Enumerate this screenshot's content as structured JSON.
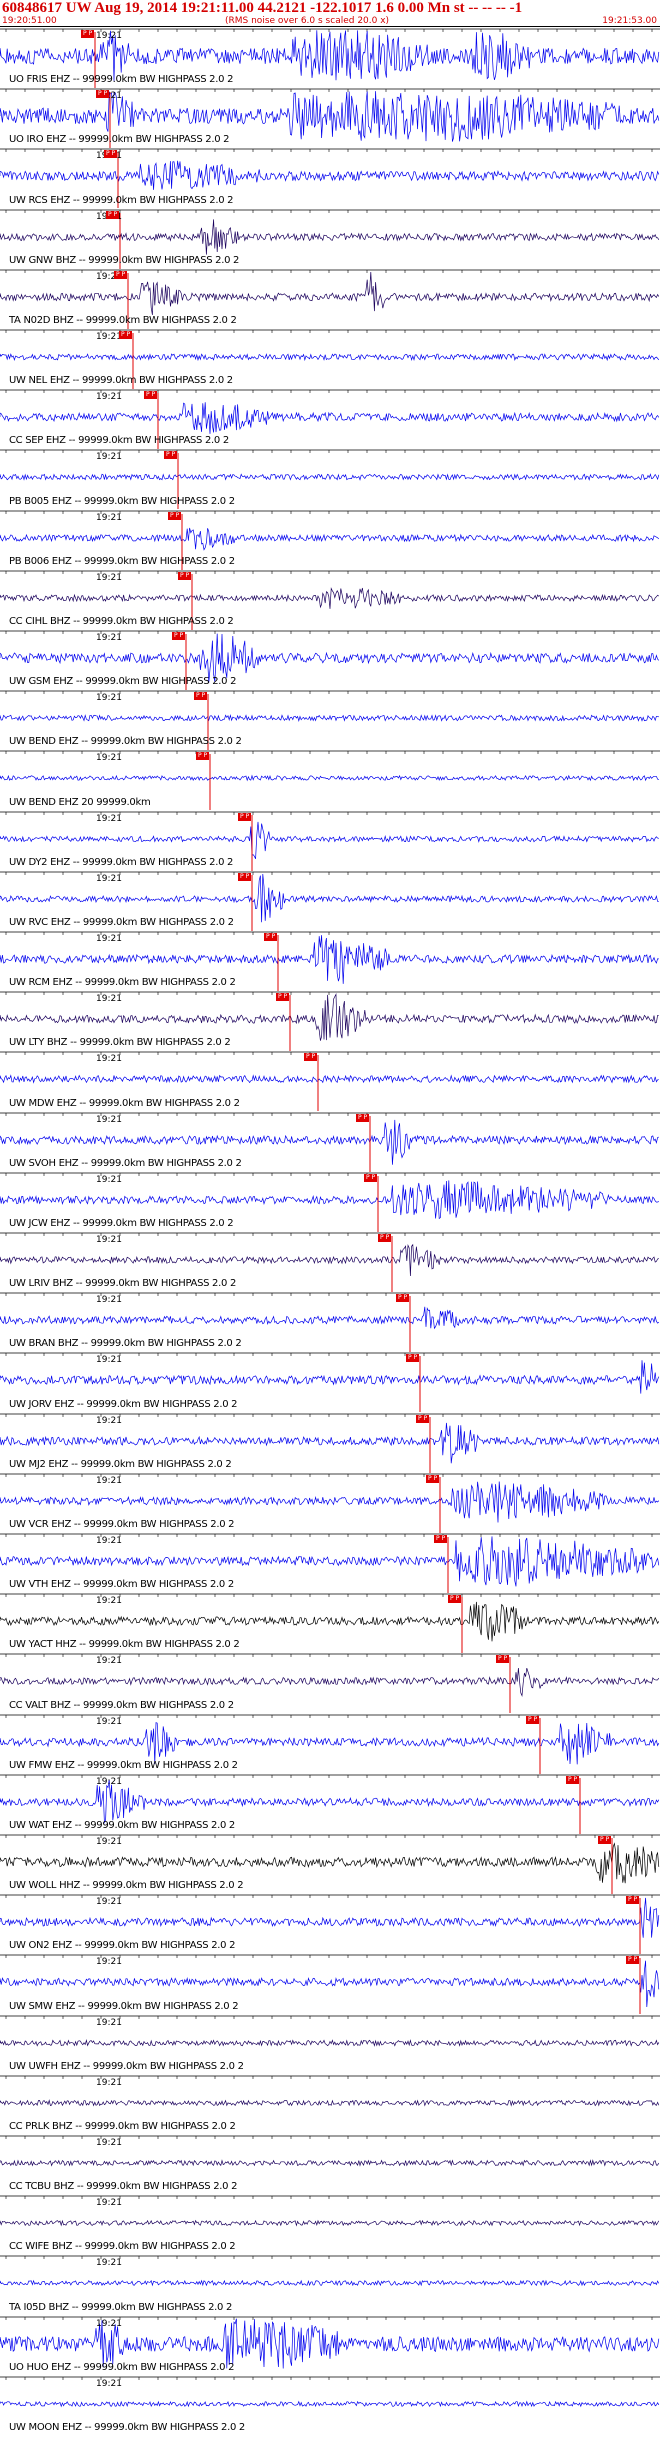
{
  "header": {
    "title": "60848617 UW Aug 19, 2014 19:21:11.00   44.2121 -122.1017  1.6 0.00 Mn st -- -- --  -1",
    "subtitle": "(RMS noise over 6.0 s scaled 20.0 x)",
    "time_left": "19:20:51.00",
    "time_right": "19:21:53.00"
  },
  "tick_label": "19:21",
  "pick_label": "P P",
  "colors": {
    "header_text": "#d40000",
    "trace_blue": "#0000ee",
    "trace_dark": "#1a005c",
    "trace_black": "#000000",
    "pick_red": "#e00000"
  },
  "traces": [
    {
      "label": "UO FRIS EHZ -- 99999.0km BW  HIGHPASS  2.0  2"
    },
    {
      "label": "UO IRO EHZ -- 99999.0km BW  HIGHPASS  2.0  2"
    },
    {
      "label": "UW RCS EHZ -- 99999.0km BW  HIGHPASS  2.0  2"
    },
    {
      "label": "UW GNW BHZ -- 99999.0km BW  HIGHPASS  2.0  2"
    },
    {
      "label": "TA N02D BHZ -- 99999.0km BW  HIGHPASS  2.0  2"
    },
    {
      "label": "UW NEL EHZ -- 99999.0km BW  HIGHPASS  2.0  2"
    },
    {
      "label": "CC SEP EHZ -- 99999.0km BW  HIGHPASS  2.0  2"
    },
    {
      "label": "PB B005 EHZ -- 99999.0km BW  HIGHPASS  2.0  2"
    },
    {
      "label": "PB B006 EHZ -- 99999.0km BW  HIGHPASS  2.0  2"
    },
    {
      "label": "CC CIHL BHZ -- 99999.0km BW  HIGHPASS  2.0  2"
    },
    {
      "label": "UW GSM EHZ -- 99999.0km BW  HIGHPASS  2.0  2"
    },
    {
      "label": "UW BEND EHZ -- 99999.0km BW  HIGHPASS  2.0  2"
    },
    {
      "label": "UW BEND EHZ 20 99999.0km"
    },
    {
      "label": "UW DY2 EHZ -- 99999.0km BW  HIGHPASS  2.0  2"
    },
    {
      "label": "UW RVC EHZ -- 99999.0km BW  HIGHPASS  2.0  2"
    },
    {
      "label": "UW RCM EHZ -- 99999.0km BW  HIGHPASS  2.0  2"
    },
    {
      "label": "UW LTY BHZ -- 99999.0km BW  HIGHPASS  2.0  2"
    },
    {
      "label": "UW MDW EHZ -- 99999.0km BW  HIGHPASS  2.0  2"
    },
    {
      "label": "UW SVOH EHZ -- 99999.0km BW  HIGHPASS  2.0  2"
    },
    {
      "label": "UW JCW EHZ -- 99999.0km BW  HIGHPASS  2.0  2"
    },
    {
      "label": "UW LRIV BHZ -- 99999.0km BW  HIGHPASS  2.0  2"
    },
    {
      "label": "UW BRAN BHZ -- 99999.0km BW  HIGHPASS  2.0  2"
    },
    {
      "label": "UW JORV EHZ -- 99999.0km BW  HIGHPASS  2.0  2"
    },
    {
      "label": "UW MJ2 EHZ -- 99999.0km BW  HIGHPASS  2.0  2"
    },
    {
      "label": "UW VCR EHZ -- 99999.0km BW  HIGHPASS  2.0  2"
    },
    {
      "label": "UW VTH EHZ -- 99999.0km BW  HIGHPASS  2.0  2"
    },
    {
      "label": "UW YACT HHZ -- 99999.0km BW  HIGHPASS  2.0  2"
    },
    {
      "label": "CC VALT BHZ -- 99999.0km BW  HIGHPASS  2.0  2"
    },
    {
      "label": "UW FMW EHZ -- 99999.0km BW  HIGHPASS  2.0  2"
    },
    {
      "label": "UW WAT EHZ -- 99999.0km BW  HIGHPASS  2.0  2"
    },
    {
      "label": "UW WOLL HHZ -- 99999.0km BW  HIGHPASS  2.0  2"
    },
    {
      "label": "UW ON2 EHZ -- 99999.0km BW  HIGHPASS  2.0  2"
    },
    {
      "label": "UW SMW EHZ -- 99999.0km BW  HIGHPASS  2.0  2"
    },
    {
      "label": "UW UWFH EHZ -- 99999.0km BW  HIGHPASS  2.0  2"
    },
    {
      "label": "CC PRLK BHZ -- 99999.0km BW  HIGHPASS  2.0  2"
    },
    {
      "label": "CC TCBU BHZ -- 99999.0km BW  HIGHPASS  2.0  2"
    },
    {
      "label": "CC WIFE BHZ -- 99999.0km BW  HIGHPASS  2.0  2"
    },
    {
      "label": "TA I05D BHZ -- 99999.0km BW  HIGHPASS  2.0  2"
    },
    {
      "label": "UO HUO EHZ -- 99999.0km BW  HIGHPASS  2.0  2"
    },
    {
      "label": "UW MOON EHZ -- 99999.0km BW  HIGHPASS  2.0  2"
    }
  ]
}
